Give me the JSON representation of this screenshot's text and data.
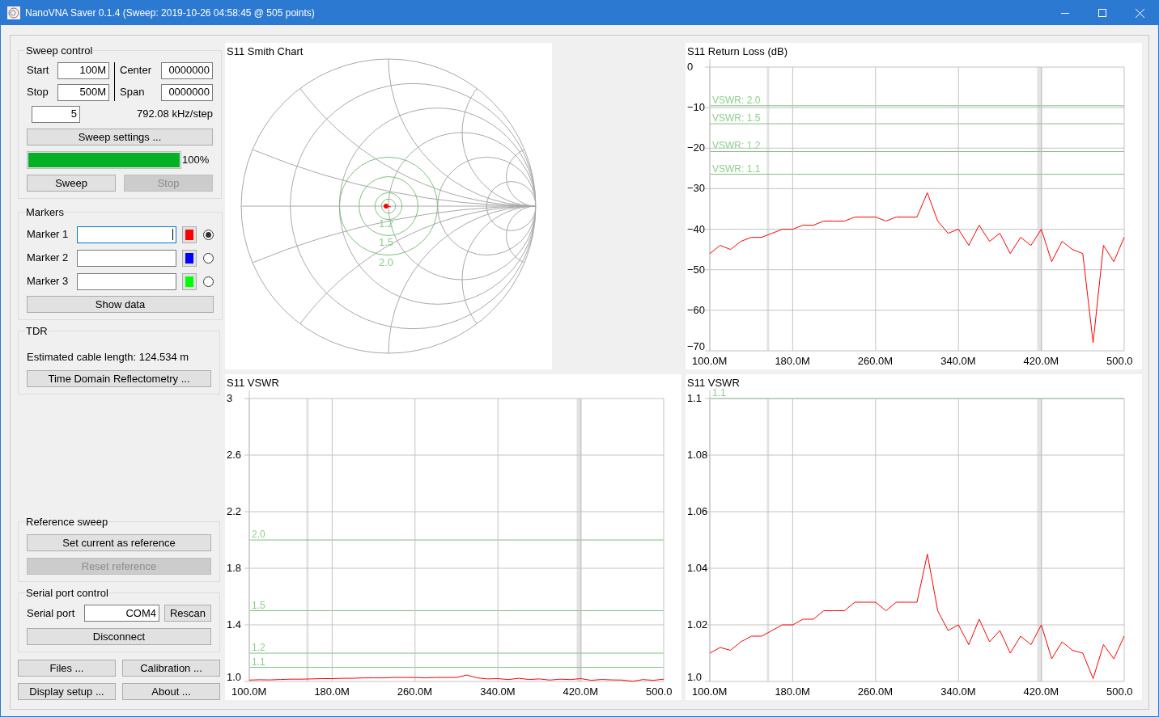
{
  "window": {
    "title": "NanoVNA Saver 0.1.4 (Sweep: 2019-10-26 04:58:45 @ 505 points)"
  },
  "sweep_control": {
    "title": "Sweep control",
    "start": {
      "label": "Start",
      "value": "100M"
    },
    "stop": {
      "label": "Stop",
      "value": "500M"
    },
    "center": {
      "label": "Center",
      "value": "0000000"
    },
    "span": {
      "label": "Span",
      "value": "0000000"
    },
    "segments": "5",
    "step": "792.08 kHz/step",
    "settings_button": "Sweep settings ...",
    "progress": {
      "level": 1.0,
      "label": "100%"
    },
    "buttons": [
      {
        "label": "Sweep",
        "disabled": false
      },
      {
        "label": "Stop",
        "disabled": true
      }
    ]
  },
  "markers": {
    "title": "Markers",
    "items": [
      {
        "label": "Marker 1",
        "color": "#ff0000",
        "selected": true,
        "focused": true
      },
      {
        "label": "Marker 2",
        "color": "#0000ff",
        "selected": false,
        "focused": false
      },
      {
        "label": "Marker 3",
        "color": "#00ff00",
        "selected": false,
        "focused": false
      }
    ],
    "show_data": "Show data"
  },
  "tdr": {
    "title": "TDR",
    "length": "Estimated cable length: 124.534 m",
    "button": "Time Domain Reflectometry ..."
  },
  "reference_sweep": {
    "title": "Reference sweep",
    "buttons": [
      {
        "label": "Set current as reference",
        "disabled": false
      },
      {
        "label": "Reset reference",
        "disabled": true
      }
    ]
  },
  "serial_port": {
    "title": "Serial port control",
    "label": "Serial port",
    "value": "COM4",
    "rescan": "Rescan",
    "disconnect": "Disconnect"
  },
  "bottom_buttons": [
    "Files ...",
    "Calibration ...",
    "Display setup ...",
    "About ..."
  ],
  "charts": [
    {
      "kind": "smith",
      "title": "S11  Smith Chart",
      "circle_labels": [
        "1.2",
        "1.5",
        "2.0"
      ]
    },
    {
      "kind": "plot",
      "vswr_labels": [
        "VSWR: 2.0",
        "VSWR: 1.5",
        "VSWR: 1.2",
        "VSWR: 1.1"
      ],
      "chart_data": {
        "type": "line",
        "title": "S11  Return Loss (dB)",
        "grid": true,
        "xlim": [
          100,
          500
        ],
        "ylim": [
          -70,
          0
        ],
        "xticks": [
          {
            "value": 100,
            "label": "100.0M"
          },
          {
            "value": 180,
            "label": "180.0M"
          },
          {
            "value": 260,
            "label": "260.0M"
          },
          {
            "value": 340,
            "label": "340.0M"
          },
          {
            "value": 420,
            "label": "420.0M"
          },
          {
            "value": 500,
            "label": "500.0"
          }
        ],
        "yticks": [
          {
            "value": 0,
            "label": "0"
          },
          {
            "value": -10,
            "label": "−10"
          },
          {
            "value": -20,
            "label": "−20"
          },
          {
            "value": -30,
            "label": "−30"
          },
          {
            "value": -40,
            "label": "−40"
          },
          {
            "value": -50,
            "label": "−50"
          },
          {
            "value": -60,
            "label": "−60"
          },
          {
            "value": -70,
            "label": "−70"
          }
        ],
        "x": [
          100,
          110,
          120,
          130,
          140,
          150,
          160,
          170,
          180,
          190,
          200,
          210,
          220,
          230,
          240,
          250,
          260,
          270,
          280,
          290,
          300,
          310,
          320,
          330,
          340,
          350,
          360,
          370,
          380,
          390,
          400,
          410,
          420,
          430,
          440,
          450,
          460,
          470,
          480,
          490,
          500
        ],
        "series": [
          {
            "color": "#ff0000",
            "values": [
              -46,
              -44,
              -45,
              -43,
              -42,
              -42,
              -41,
              -40,
              -40,
              -39,
              -39,
              -38,
              -38,
              -38,
              -37,
              -37,
              -37,
              -38,
              -37,
              -37,
              -37,
              -31,
              -38,
              -41,
              -40,
              -44,
              -39,
              -43,
              -41,
              -46,
              -42,
              -44,
              -40,
              -48,
              -43,
              -45,
              -46,
              -68,
              -44,
              -48,
              -42
            ]
          }
        ]
      }
    },
    {
      "kind": "plot",
      "vswr_labels": [
        "2.0",
        "1.5",
        "1.2",
        "1.1"
      ],
      "chart_data": {
        "type": "line",
        "title": "S11  VSWR",
        "grid": true,
        "xlim": [
          100,
          500
        ],
        "ylim": [
          1.0,
          3.0
        ],
        "xticks": [
          {
            "value": 100,
            "label": "100.0M"
          },
          {
            "value": 180,
            "label": "180.0M"
          },
          {
            "value": 260,
            "label": "260.0M"
          },
          {
            "value": 340,
            "label": "340.0M"
          },
          {
            "value": 420,
            "label": "420.0M"
          },
          {
            "value": 500,
            "label": "500.0"
          }
        ],
        "yticks": [
          {
            "value": 3.0,
            "label": "3"
          },
          {
            "value": 2.6,
            "label": "2.6"
          },
          {
            "value": 2.2,
            "label": "2.2"
          },
          {
            "value": 1.8,
            "label": "1.8"
          },
          {
            "value": 1.4,
            "label": "1.4"
          },
          {
            "value": 1.0,
            "label": "1.0"
          }
        ],
        "x": [
          100,
          110,
          120,
          130,
          140,
          150,
          160,
          170,
          180,
          190,
          200,
          210,
          220,
          230,
          240,
          250,
          260,
          270,
          280,
          290,
          300,
          310,
          320,
          330,
          340,
          350,
          360,
          370,
          380,
          390,
          400,
          410,
          420,
          430,
          440,
          450,
          460,
          470,
          480,
          490,
          500
        ],
        "series": [
          {
            "color": "#ff0000",
            "values": [
              1.01,
              1.012,
              1.011,
              1.014,
              1.016,
              1.016,
              1.018,
              1.02,
              1.02,
              1.022,
              1.022,
              1.025,
              1.025,
              1.025,
              1.028,
              1.028,
              1.028,
              1.025,
              1.028,
              1.028,
              1.028,
              1.045,
              1.025,
              1.018,
              1.02,
              1.013,
              1.022,
              1.014,
              1.018,
              1.01,
              1.016,
              1.013,
              1.02,
              1.008,
              1.014,
              1.011,
              1.01,
              1.001,
              1.013,
              1.008,
              1.016
            ]
          }
        ]
      }
    },
    {
      "kind": "plot",
      "vswr_labels": [
        "1.1"
      ],
      "chart_data": {
        "type": "line",
        "title": "S11  VSWR",
        "grid": true,
        "xlim": [
          100,
          500
        ],
        "ylim": [
          1.0,
          1.1
        ],
        "xticks": [
          {
            "value": 100,
            "label": "100.0M"
          },
          {
            "value": 180,
            "label": "180.0M"
          },
          {
            "value": 260,
            "label": "260.0M"
          },
          {
            "value": 340,
            "label": "340.0M"
          },
          {
            "value": 420,
            "label": "420.0M"
          },
          {
            "value": 500,
            "label": "500.0"
          }
        ],
        "yticks": [
          {
            "value": 1.1,
            "label": "1.1"
          },
          {
            "value": 1.08,
            "label": "1.08"
          },
          {
            "value": 1.06,
            "label": "1.06"
          },
          {
            "value": 1.04,
            "label": "1.04"
          },
          {
            "value": 1.02,
            "label": "1.02"
          },
          {
            "value": 1.0,
            "label": "1.0"
          }
        ],
        "x": [
          100,
          110,
          120,
          130,
          140,
          150,
          160,
          170,
          180,
          190,
          200,
          210,
          220,
          230,
          240,
          250,
          260,
          270,
          280,
          290,
          300,
          310,
          320,
          330,
          340,
          350,
          360,
          370,
          380,
          390,
          400,
          410,
          420,
          430,
          440,
          450,
          460,
          470,
          480,
          490,
          500
        ],
        "series": [
          {
            "color": "#ff0000",
            "values": [
              1.01,
              1.012,
              1.011,
              1.014,
              1.016,
              1.016,
              1.018,
              1.02,
              1.02,
              1.022,
              1.022,
              1.025,
              1.025,
              1.025,
              1.028,
              1.028,
              1.028,
              1.025,
              1.028,
              1.028,
              1.028,
              1.045,
              1.025,
              1.018,
              1.02,
              1.013,
              1.022,
              1.014,
              1.018,
              1.01,
              1.016,
              1.013,
              1.02,
              1.008,
              1.014,
              1.011,
              1.01,
              1.001,
              1.013,
              1.008,
              1.016
            ]
          }
        ]
      }
    }
  ]
}
